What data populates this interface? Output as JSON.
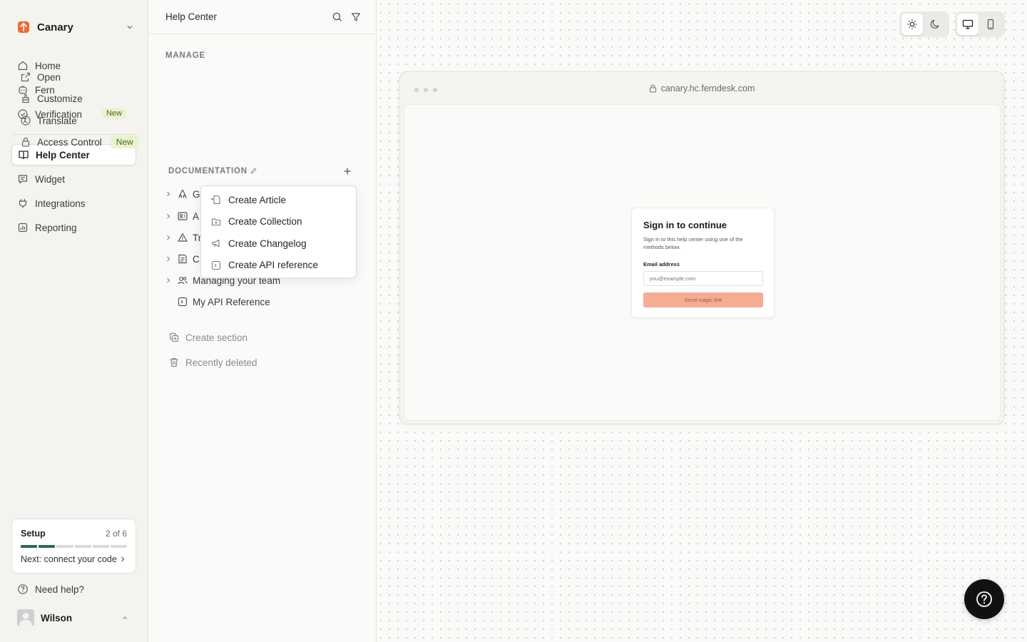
{
  "workspace": {
    "name": "Canary",
    "brand_color": "#f26a2e"
  },
  "sidebar": {
    "items": [
      {
        "label": "Home",
        "icon": "home-icon"
      },
      {
        "label": "Fern",
        "icon": "fern-icon"
      },
      {
        "label": "Verification",
        "icon": "verified-icon",
        "badge": "New"
      },
      {
        "label": "Help Center",
        "icon": "book-icon",
        "active": true
      },
      {
        "label": "Widget",
        "icon": "chat-icon"
      },
      {
        "label": "Integrations",
        "icon": "plug-icon"
      },
      {
        "label": "Reporting",
        "icon": "chart-icon"
      }
    ],
    "setup": {
      "title": "Setup",
      "progress_label": "2 of 6",
      "completed_steps": 2,
      "total_steps": 6,
      "next": "Next: connect your code"
    },
    "help_label": "Need help?",
    "user": {
      "name": "Wilson"
    }
  },
  "panel": {
    "title": "Help Center",
    "manage": {
      "label": "MANAGE",
      "items": [
        {
          "label": "Open",
          "icon": "external-link-icon"
        },
        {
          "label": "Customize",
          "icon": "brush-icon"
        },
        {
          "label": "Translate",
          "icon": "translate-icon"
        },
        {
          "label": "Access Control",
          "icon": "lock-icon",
          "badge": "New"
        }
      ]
    },
    "documentation": {
      "label": "DOCUMENTATION",
      "tree": [
        {
          "label": "G",
          "icon": "rocket-icon",
          "expandable": true
        },
        {
          "label": "A",
          "icon": "id-card-icon",
          "expandable": true
        },
        {
          "label": "Tr",
          "icon": "warning-icon",
          "expandable": true
        },
        {
          "label": "C",
          "icon": "document-icon",
          "expandable": true
        },
        {
          "label": "Managing your team",
          "icon": "users-icon",
          "expandable": true
        },
        {
          "label": "My API Reference",
          "icon": "api-icon",
          "expandable": false
        }
      ]
    },
    "create_section_label": "Create section",
    "recently_deleted_label": "Recently deleted"
  },
  "create_menu": {
    "items": [
      {
        "label": "Create Article",
        "icon": "article-plus-icon"
      },
      {
        "label": "Create Collection",
        "icon": "folder-plus-icon"
      },
      {
        "label": "Create Changelog",
        "icon": "megaphone-icon"
      },
      {
        "label": "Create API reference",
        "icon": "api-icon"
      }
    ]
  },
  "preview": {
    "url": "canary.hc.ferndesk.com",
    "theme": "light",
    "device": "desktop",
    "signin": {
      "title": "Sign in to continue",
      "subtitle": "Sign in to this help center using one of the methods below.",
      "email_label": "Email address",
      "email_placeholder": "you@example.com",
      "button_label": "Send magic link",
      "button_color": "#f3ad92"
    }
  }
}
